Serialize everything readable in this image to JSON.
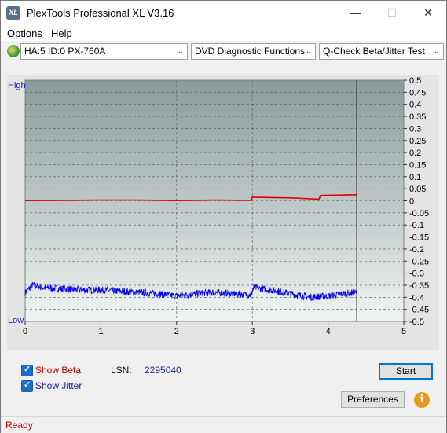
{
  "window": {
    "title": "PlexTools Professional XL V3.16",
    "app_icon_text": "XL"
  },
  "window_controls": {
    "minimize": "—",
    "maximize": "☐",
    "close": "✕"
  },
  "menu": [
    {
      "label": "Options"
    },
    {
      "label": "Help"
    }
  ],
  "toolbar": {
    "drive": "HA:5 ID:0  PX-760A",
    "function": "DVD Diagnostic Functions",
    "test": "Q-Check Beta/Jitter Test",
    "dropdown_glyph": "⌄"
  },
  "chart_labels": {
    "high": "High",
    "low": "Low"
  },
  "chart_data": {
    "type": "line",
    "x_ticks": [
      "0",
      "1",
      "2",
      "3",
      "4",
      "5"
    ],
    "y_ticks": [
      "0.5",
      "0.45",
      "0.4",
      "0.35",
      "0.3",
      "0.25",
      "0.2",
      "0.15",
      "0.1",
      "0.05",
      "0",
      "-0.05",
      "-0.1",
      "-0.15",
      "-0.2",
      "-0.25",
      "-0.3",
      "-0.35",
      "-0.4",
      "-0.45",
      "-0.5"
    ],
    "xlim": [
      0,
      5
    ],
    "ylim": [
      -0.5,
      0.5
    ],
    "grid": true,
    "cursor_x": 4.38,
    "series": [
      {
        "color": "#e00000",
        "x": [
          0,
          0.5,
          1,
          1.5,
          2,
          2.5,
          2.99,
          3.0,
          3.5,
          3.88,
          3.9,
          4.38
        ],
        "y": [
          0.001,
          0.002,
          0.003,
          0.003,
          0.001,
          0.003,
          0.002,
          0.015,
          0.012,
          0.007,
          0.022,
          0.025
        ]
      },
      {
        "color": "#0000ee",
        "x": [
          0,
          0.1,
          0.25,
          0.5,
          0.75,
          1.0,
          1.25,
          1.5,
          1.75,
          2.0,
          2.25,
          2.5,
          2.75,
          2.98,
          3.02,
          3.25,
          3.5,
          3.75,
          4.0,
          4.2,
          4.38
        ],
        "y": [
          -0.38,
          -0.35,
          -0.36,
          -0.365,
          -0.37,
          -0.37,
          -0.375,
          -0.38,
          -0.385,
          -0.395,
          -0.385,
          -0.38,
          -0.385,
          -0.39,
          -0.36,
          -0.37,
          -0.385,
          -0.4,
          -0.395,
          -0.385,
          -0.38
        ],
        "noise": 0.03
      }
    ]
  },
  "controls": {
    "show_beta": "Show Beta",
    "show_jitter": "Show Jitter",
    "show_beta_checked": true,
    "show_jitter_checked": true,
    "lsn_label": "LSN:",
    "lsn_value": "2295040",
    "start": "Start",
    "preferences": "Preferences",
    "info_icon": "i",
    "check_glyph": "✓"
  },
  "colors": {
    "beta_label": "#c00000",
    "jitter_label": "#1a1aa0",
    "status": "#c00000"
  },
  "status": {
    "text": "Ready"
  }
}
